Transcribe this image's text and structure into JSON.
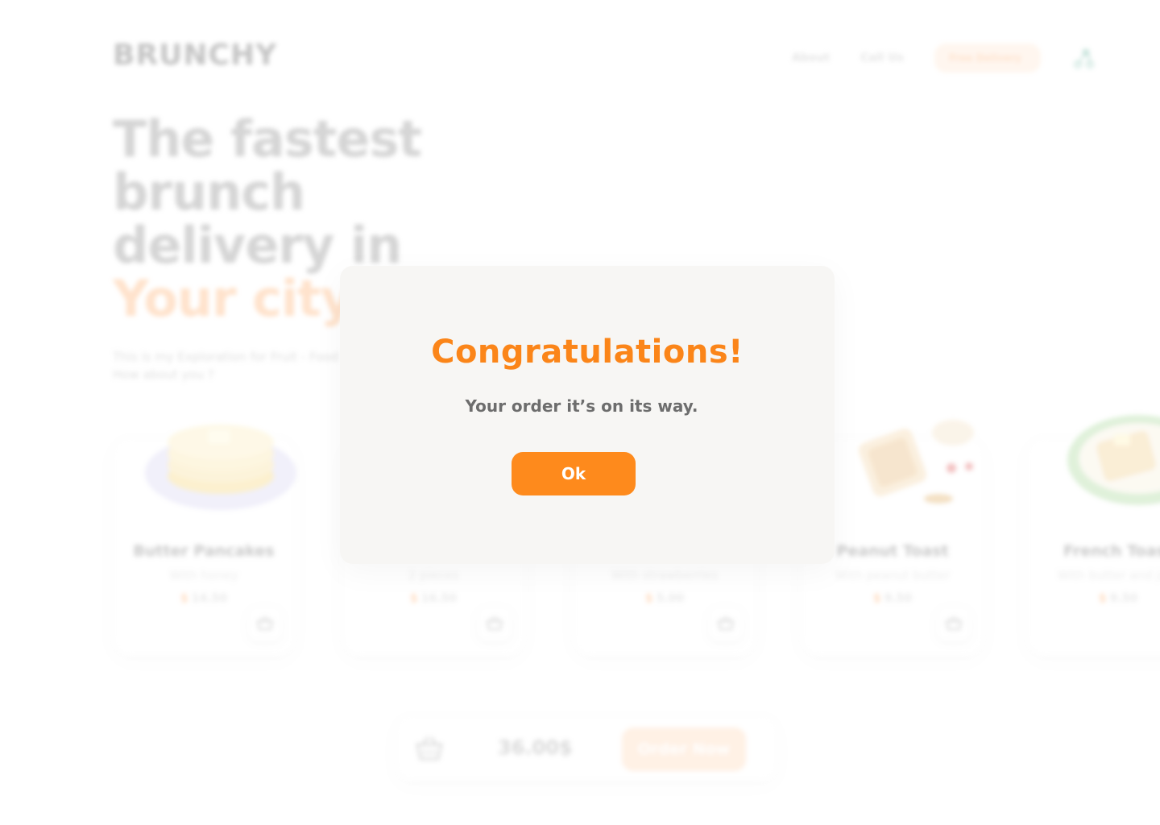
{
  "brand": {
    "name": "BRUNCHY"
  },
  "nav": {
    "about": "About",
    "call_us": "Call Us",
    "cta": "Free Delivery",
    "icon": "delivery-scooter-icon"
  },
  "hero": {
    "line1": "The fastest",
    "line2": "brunch",
    "line3": "delivery in",
    "accent": "Your city",
    "sub_line1": "This is my Exploration for Fruit - Food",
    "sub_line2": "How about you ?"
  },
  "products": [
    {
      "title": "Butter Pancakes",
      "desc": "With honey",
      "currency": "$",
      "price": "14.50"
    },
    {
      "title": "",
      "desc": "2 pieces",
      "currency": "$",
      "price": "16.50"
    },
    {
      "title": "",
      "desc": "With strawberries",
      "currency": "$",
      "price": "5.00"
    },
    {
      "title": "Peanut Toast",
      "desc": "With peanut butter",
      "currency": "$",
      "price": "9.50"
    },
    {
      "title": "French Toast",
      "desc": "With butter and jam",
      "currency": "$",
      "price": "9.50"
    }
  ],
  "order": {
    "total": "36.00$",
    "button": "Order Now"
  },
  "modal": {
    "title": "Congratulations!",
    "message": "Your order it’s on its way.",
    "ok": "Ok"
  },
  "colors": {
    "accent": "#fb8519",
    "button": "#fe8a1c",
    "modal_bg": "#f7f6f4",
    "text_gray": "#6d6d6d"
  }
}
